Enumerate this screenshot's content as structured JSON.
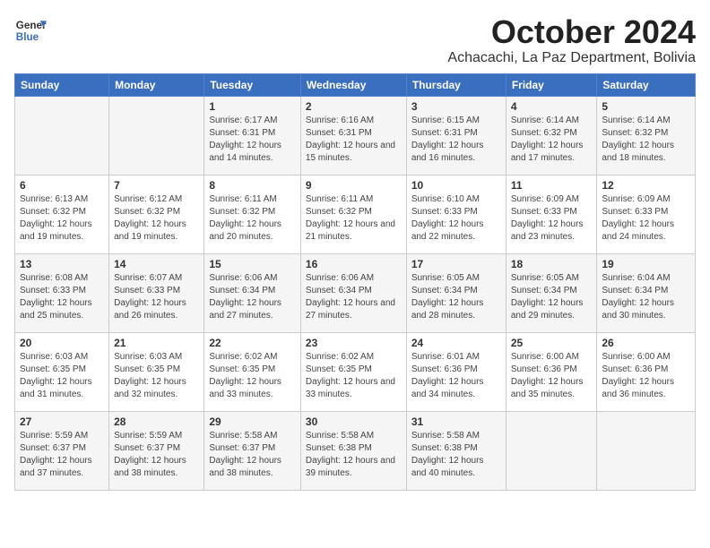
{
  "logo": {
    "line1": "General",
    "line2": "Blue"
  },
  "title": "October 2024",
  "location": "Achacachi, La Paz Department, Bolivia",
  "days_of_week": [
    "Sunday",
    "Monday",
    "Tuesday",
    "Wednesday",
    "Thursday",
    "Friday",
    "Saturday"
  ],
  "weeks": [
    [
      {
        "day": "",
        "sunrise": "",
        "sunset": "",
        "daylight": ""
      },
      {
        "day": "",
        "sunrise": "",
        "sunset": "",
        "daylight": ""
      },
      {
        "day": "1",
        "sunrise": "Sunrise: 6:17 AM",
        "sunset": "Sunset: 6:31 PM",
        "daylight": "Daylight: 12 hours and 14 minutes."
      },
      {
        "day": "2",
        "sunrise": "Sunrise: 6:16 AM",
        "sunset": "Sunset: 6:31 PM",
        "daylight": "Daylight: 12 hours and 15 minutes."
      },
      {
        "day": "3",
        "sunrise": "Sunrise: 6:15 AM",
        "sunset": "Sunset: 6:31 PM",
        "daylight": "Daylight: 12 hours and 16 minutes."
      },
      {
        "day": "4",
        "sunrise": "Sunrise: 6:14 AM",
        "sunset": "Sunset: 6:32 PM",
        "daylight": "Daylight: 12 hours and 17 minutes."
      },
      {
        "day": "5",
        "sunrise": "Sunrise: 6:14 AM",
        "sunset": "Sunset: 6:32 PM",
        "daylight": "Daylight: 12 hours and 18 minutes."
      }
    ],
    [
      {
        "day": "6",
        "sunrise": "Sunrise: 6:13 AM",
        "sunset": "Sunset: 6:32 PM",
        "daylight": "Daylight: 12 hours and 19 minutes."
      },
      {
        "day": "7",
        "sunrise": "Sunrise: 6:12 AM",
        "sunset": "Sunset: 6:32 PM",
        "daylight": "Daylight: 12 hours and 19 minutes."
      },
      {
        "day": "8",
        "sunrise": "Sunrise: 6:11 AM",
        "sunset": "Sunset: 6:32 PM",
        "daylight": "Daylight: 12 hours and 20 minutes."
      },
      {
        "day": "9",
        "sunrise": "Sunrise: 6:11 AM",
        "sunset": "Sunset: 6:32 PM",
        "daylight": "Daylight: 12 hours and 21 minutes."
      },
      {
        "day": "10",
        "sunrise": "Sunrise: 6:10 AM",
        "sunset": "Sunset: 6:33 PM",
        "daylight": "Daylight: 12 hours and 22 minutes."
      },
      {
        "day": "11",
        "sunrise": "Sunrise: 6:09 AM",
        "sunset": "Sunset: 6:33 PM",
        "daylight": "Daylight: 12 hours and 23 minutes."
      },
      {
        "day": "12",
        "sunrise": "Sunrise: 6:09 AM",
        "sunset": "Sunset: 6:33 PM",
        "daylight": "Daylight: 12 hours and 24 minutes."
      }
    ],
    [
      {
        "day": "13",
        "sunrise": "Sunrise: 6:08 AM",
        "sunset": "Sunset: 6:33 PM",
        "daylight": "Daylight: 12 hours and 25 minutes."
      },
      {
        "day": "14",
        "sunrise": "Sunrise: 6:07 AM",
        "sunset": "Sunset: 6:33 PM",
        "daylight": "Daylight: 12 hours and 26 minutes."
      },
      {
        "day": "15",
        "sunrise": "Sunrise: 6:06 AM",
        "sunset": "Sunset: 6:34 PM",
        "daylight": "Daylight: 12 hours and 27 minutes."
      },
      {
        "day": "16",
        "sunrise": "Sunrise: 6:06 AM",
        "sunset": "Sunset: 6:34 PM",
        "daylight": "Daylight: 12 hours and 27 minutes."
      },
      {
        "day": "17",
        "sunrise": "Sunrise: 6:05 AM",
        "sunset": "Sunset: 6:34 PM",
        "daylight": "Daylight: 12 hours and 28 minutes."
      },
      {
        "day": "18",
        "sunrise": "Sunrise: 6:05 AM",
        "sunset": "Sunset: 6:34 PM",
        "daylight": "Daylight: 12 hours and 29 minutes."
      },
      {
        "day": "19",
        "sunrise": "Sunrise: 6:04 AM",
        "sunset": "Sunset: 6:34 PM",
        "daylight": "Daylight: 12 hours and 30 minutes."
      }
    ],
    [
      {
        "day": "20",
        "sunrise": "Sunrise: 6:03 AM",
        "sunset": "Sunset: 6:35 PM",
        "daylight": "Daylight: 12 hours and 31 minutes."
      },
      {
        "day": "21",
        "sunrise": "Sunrise: 6:03 AM",
        "sunset": "Sunset: 6:35 PM",
        "daylight": "Daylight: 12 hours and 32 minutes."
      },
      {
        "day": "22",
        "sunrise": "Sunrise: 6:02 AM",
        "sunset": "Sunset: 6:35 PM",
        "daylight": "Daylight: 12 hours and 33 minutes."
      },
      {
        "day": "23",
        "sunrise": "Sunrise: 6:02 AM",
        "sunset": "Sunset: 6:35 PM",
        "daylight": "Daylight: 12 hours and 33 minutes."
      },
      {
        "day": "24",
        "sunrise": "Sunrise: 6:01 AM",
        "sunset": "Sunset: 6:36 PM",
        "daylight": "Daylight: 12 hours and 34 minutes."
      },
      {
        "day": "25",
        "sunrise": "Sunrise: 6:00 AM",
        "sunset": "Sunset: 6:36 PM",
        "daylight": "Daylight: 12 hours and 35 minutes."
      },
      {
        "day": "26",
        "sunrise": "Sunrise: 6:00 AM",
        "sunset": "Sunset: 6:36 PM",
        "daylight": "Daylight: 12 hours and 36 minutes."
      }
    ],
    [
      {
        "day": "27",
        "sunrise": "Sunrise: 5:59 AM",
        "sunset": "Sunset: 6:37 PM",
        "daylight": "Daylight: 12 hours and 37 minutes."
      },
      {
        "day": "28",
        "sunrise": "Sunrise: 5:59 AM",
        "sunset": "Sunset: 6:37 PM",
        "daylight": "Daylight: 12 hours and 38 minutes."
      },
      {
        "day": "29",
        "sunrise": "Sunrise: 5:58 AM",
        "sunset": "Sunset: 6:37 PM",
        "daylight": "Daylight: 12 hours and 38 minutes."
      },
      {
        "day": "30",
        "sunrise": "Sunrise: 5:58 AM",
        "sunset": "Sunset: 6:38 PM",
        "daylight": "Daylight: 12 hours and 39 minutes."
      },
      {
        "day": "31",
        "sunrise": "Sunrise: 5:58 AM",
        "sunset": "Sunset: 6:38 PM",
        "daylight": "Daylight: 12 hours and 40 minutes."
      },
      {
        "day": "",
        "sunrise": "",
        "sunset": "",
        "daylight": ""
      },
      {
        "day": "",
        "sunrise": "",
        "sunset": "",
        "daylight": ""
      }
    ]
  ]
}
